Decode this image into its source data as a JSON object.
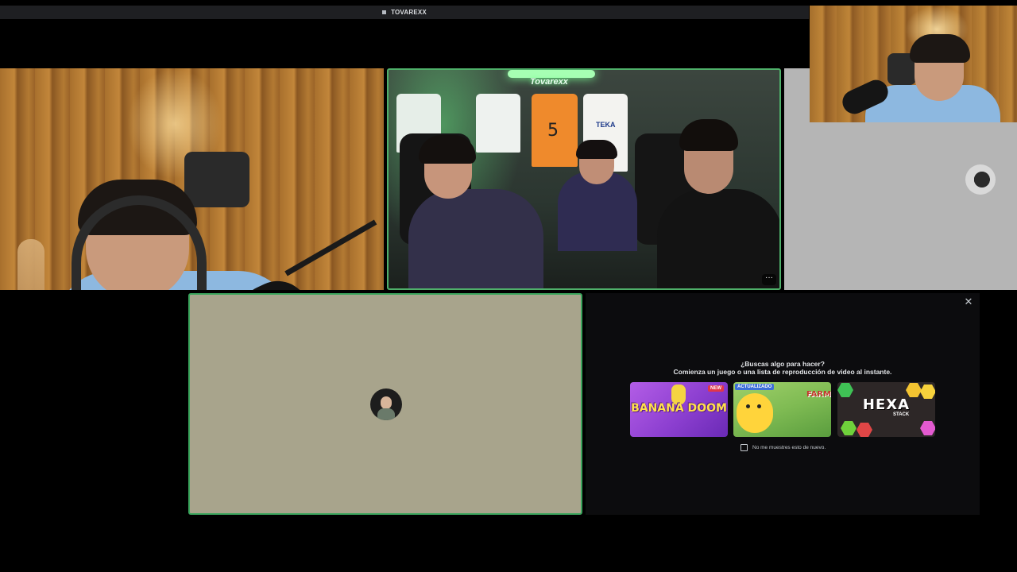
{
  "window": {
    "title": "TOVAREXX"
  },
  "streams": {
    "room_brand": "Tovarexx",
    "jersey_number": "5",
    "jersey_sponsor": "TEKA",
    "more_label": "···"
  },
  "activity_panel": {
    "close_label": "✕",
    "heading": "¿Buscas algo para hacer?",
    "subheading": "Comienza un juego o una lista de reproducción de video al instante.",
    "games": [
      {
        "title": "BANANA DOOM",
        "badge": "NEW"
      },
      {
        "title": "FARM",
        "badge": "ACTUALIZADO"
      },
      {
        "title": "HEXA",
        "subtitle": "STACK"
      }
    ],
    "dont_show_label": "No me muestres esto de nuevo."
  },
  "colors": {
    "speaking_border": "#3ba55d",
    "panel_bg": "#0c0c0e",
    "new_badge": "#e0364a",
    "updated_badge": "#3d6fd8"
  }
}
